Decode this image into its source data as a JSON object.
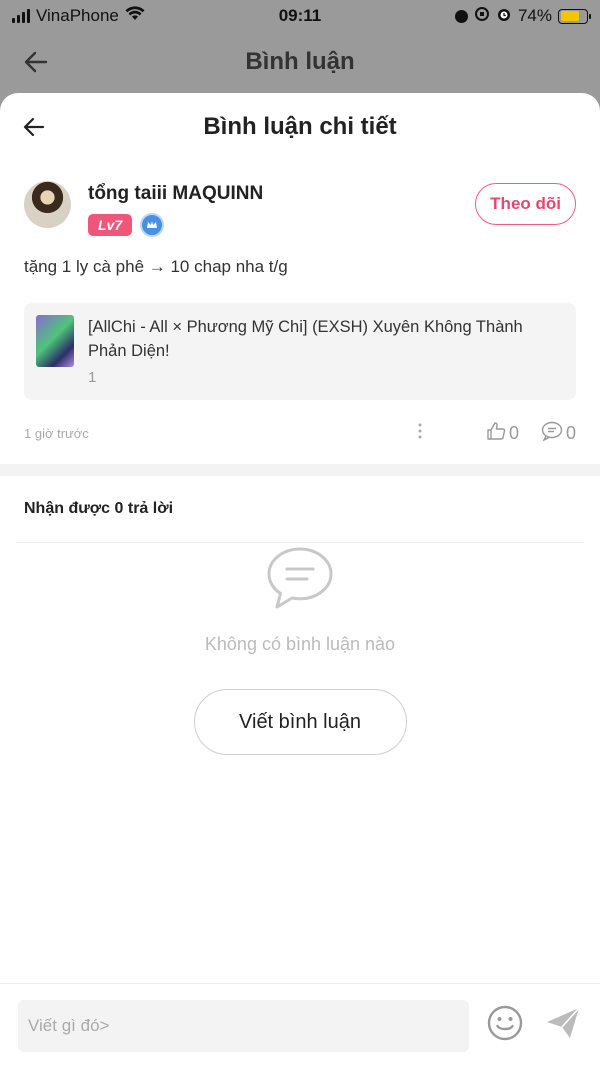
{
  "status_bar": {
    "carrier": "VinaPhone",
    "time": "09:11",
    "battery_percent": "74%",
    "battery_level": 0.74
  },
  "background_header": {
    "title": "Bình luận"
  },
  "sheet": {
    "title": "Bình luận chi tiết"
  },
  "comment": {
    "user_name": "tổng taiii MAQUINN",
    "level_badge": "Lv7",
    "follow_label": "Theo dõi",
    "text": "tặng 1 ly cà phê → 10 chap nha t/g",
    "story": {
      "title": "[AllChi - All × Phương Mỹ Chi] (EXSH) Xuyên Không Thành Phản Diện!",
      "chapter": "1"
    },
    "time_ago": "1 giờ trước",
    "likes": "0",
    "replies": "0"
  },
  "replies_section": {
    "title": "Nhận được 0 trả lời",
    "empty_text": "Không có bình luận nào",
    "write_button": "Viết bình luận"
  },
  "bottom_bar": {
    "placeholder": "Viết gì đó>"
  },
  "colors": {
    "accent_pink": "#e8466f",
    "level_badge_bg": "#f0567a",
    "battery_yellow": "#f5c400"
  },
  "icons": [
    "back-arrow-icon",
    "wifi-icon",
    "more-vertical-icon",
    "thumbs-up-icon",
    "comment-icon",
    "chat-bubble-icon",
    "emoji-icon",
    "send-icon",
    "crown-icon"
  ]
}
